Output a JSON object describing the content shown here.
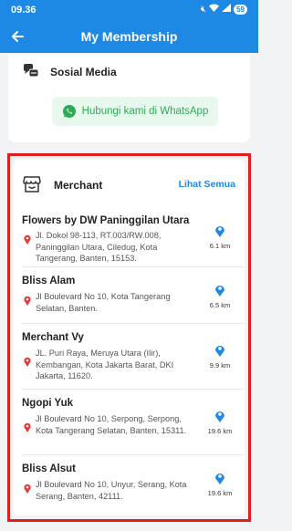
{
  "status_bar": {
    "time": "09.36",
    "battery": "59"
  },
  "header": {
    "title": "My Membership"
  },
  "social": {
    "title": "Sosial Media",
    "whatsapp_button": "Hubungi kami di WhatsApp"
  },
  "merchant": {
    "title": "Merchant",
    "see_all": "Lihat Semua",
    "items": [
      {
        "name": "Flowers by DW Paninggilan Utara",
        "address": "Jl. Dokol 98-113, RT.003/RW.008, Paninggilan Utara, Ciledug, Kota Tangerang, Banten, 15153.",
        "distance": "6.1 km"
      },
      {
        "name": "Bliss Alam",
        "address": "Jl Boulevard No 10, Kota Tangerang Selatan, Banten.",
        "distance": "6.5 km"
      },
      {
        "name": "Merchant Vy",
        "address": "JL. Puri Raya, Meruya Utara (Ilir), Kembangan, Kota Jakarta Barat, DKI Jakarta, 11620.",
        "distance": "9.9 km"
      },
      {
        "name": "Ngopi Yuk",
        "address": "Jl Boulevard No 10, Serpong, Serpong, Kota Tangerang Selatan, Banten, 15311.",
        "distance": "19.6 km"
      },
      {
        "name": "Bliss Alsut",
        "address": "Jl Boulevard No 10, Unyur, Serang, Kota Serang, Banten, 42111.",
        "distance": "19.6 km"
      }
    ]
  },
  "colors": {
    "primary": "#1e88e5",
    "whatsapp": "#2faa55",
    "highlight": "#e01e1e",
    "pin": "#e53935"
  }
}
